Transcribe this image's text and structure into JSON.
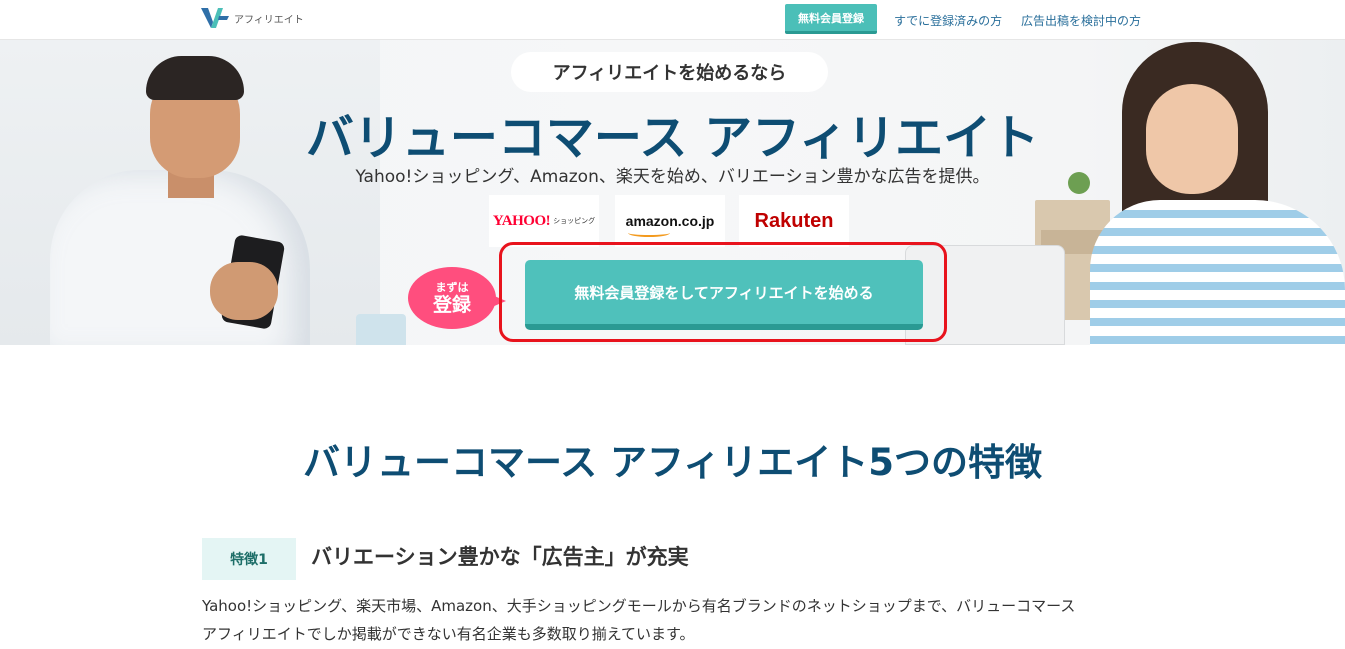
{
  "header": {
    "logo_text": "アフィリエイト",
    "register_label": "無料会員登録",
    "login_link": "すでに登録済みの方",
    "advertiser_link": "広告出稿を検討中の方"
  },
  "hero": {
    "pill": "アフィリエイトを始めるなら",
    "title": "バリューコマース アフィリエイト",
    "subtitle": "Yahoo!ショッピング、Amazon、楽天を始め、バリエーション豊かな広告を提供。",
    "partners": {
      "yahoo_word": "YAHOO!",
      "yahoo_sub": "ショッピング",
      "amazon_word": "amazon.co.jp",
      "rakuten_word": "Rakuten"
    },
    "badge_top": "まずは",
    "badge_bottom": "登録",
    "cta_label": "無料会員登録をしてアフィリエイトを始める"
  },
  "features": {
    "title": "バリューコマース アフィリエイト5つの特徴",
    "items": [
      {
        "tag": "特徴1",
        "heading": "バリエーション豊かな「広告主」が充実",
        "text_line1": "Yahoo!ショッピング、楽天市場、Amazon、大手ショッピングモールから有名ブランドのネットショップまで、バリューコマース",
        "text_line2": "アフィリエイトでしか掲載ができない有名企業も多数取り揃えています。"
      }
    ]
  },
  "colors": {
    "brand_navy": "#0e4d73",
    "teal": "#4fc1bb",
    "badge_pink": "#ff4e7e",
    "highlight_red": "#e8131d"
  }
}
